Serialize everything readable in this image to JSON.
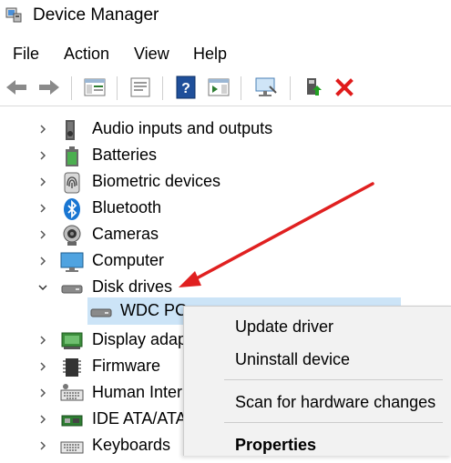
{
  "window": {
    "title": "Device Manager"
  },
  "menu": [
    "File",
    "Action",
    "View",
    "Help"
  ],
  "toolbar_icons": [
    "back-arrow-icon",
    "forward-arrow-icon",
    "show-hide-console-tree-icon",
    "properties-icon",
    "help-icon",
    "action-pane-icon",
    "monitor-icon",
    "update-driver-icon",
    "uninstall-icon"
  ],
  "tree": {
    "items": [
      {
        "label": "Audio inputs and outputs",
        "icon": "speaker-icon",
        "expanded": false
      },
      {
        "label": "Batteries",
        "icon": "battery-icon",
        "expanded": false
      },
      {
        "label": "Biometric devices",
        "icon": "fingerprint-icon",
        "expanded": false
      },
      {
        "label": "Bluetooth",
        "icon": "bluetooth-icon",
        "expanded": false
      },
      {
        "label": "Cameras",
        "icon": "camera-icon",
        "expanded": false
      },
      {
        "label": "Computer",
        "icon": "computer-icon",
        "expanded": false
      },
      {
        "label": "Disk drives",
        "icon": "disk-drive-icon",
        "expanded": true
      },
      {
        "label": "WDC PC",
        "icon": "disk-drive-icon",
        "child": true,
        "selected": true
      },
      {
        "label": "Display adap",
        "icon": "display-adapter-icon",
        "expanded": false
      },
      {
        "label": "Firmware",
        "icon": "firmware-icon",
        "expanded": false
      },
      {
        "label": "Human Inter",
        "icon": "keyboard-icon",
        "expanded": false
      },
      {
        "label": "IDE ATA/ATAP",
        "icon": "ide-controller-icon",
        "expanded": false
      },
      {
        "label": "Keyboards",
        "icon": "keyboard-icon",
        "expanded": false
      }
    ]
  },
  "context_menu": {
    "items": [
      {
        "label": "Update driver"
      },
      {
        "label": "Uninstall device"
      },
      {
        "label": "Scan for hardware changes"
      },
      {
        "label": "Properties",
        "bold": true
      }
    ]
  },
  "colors": {
    "selection": "#cce4f7",
    "arrow": "#e02020",
    "accent": "#0078d7"
  }
}
